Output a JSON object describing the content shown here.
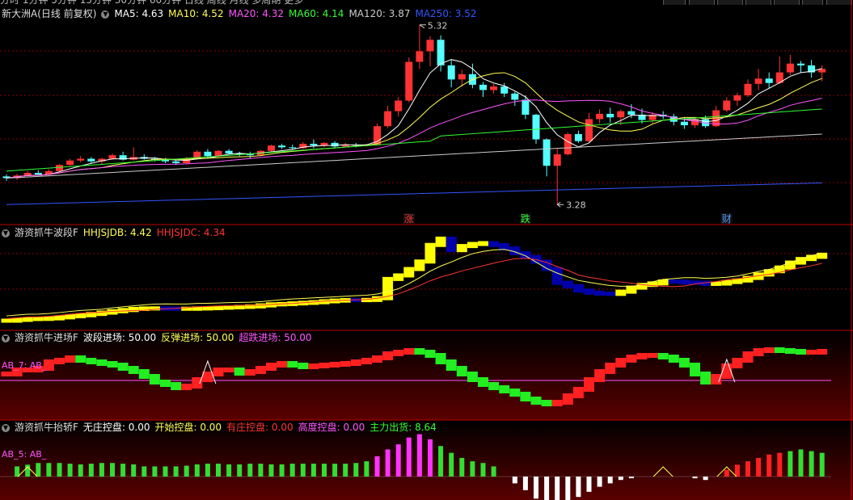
{
  "colors": {
    "up": "#ff3333",
    "down": "#54ffff",
    "ma5": "#ffffff",
    "ma10": "#ffff55",
    "ma20": "#ff55ff",
    "ma60": "#33ff33",
    "ma120": "#cccccc",
    "ma250": "#3355ff",
    "grid": "#8b0000"
  },
  "main": {
    "title": "新大洲A(日线 前复权)",
    "ma": [
      {
        "label": "MA5: 4.63",
        "color": "#ffffff"
      },
      {
        "label": "MA10: 4.52",
        "color": "#ffff55"
      },
      {
        "label": "MA20: 4.32",
        "color": "#ff55ff"
      },
      {
        "label": "MA60: 4.14",
        "color": "#33ff33"
      },
      {
        "label": "MA120: 3.87",
        "color": "#cccccc"
      },
      {
        "label": "MA250: 3.52",
        "color": "#3355ff"
      }
    ],
    "high_label": "5.32",
    "low_label": "3.28",
    "markers": [
      "涨",
      "跌",
      "财"
    ]
  },
  "panel2": {
    "title": "游资抓牛波段F",
    "items": [
      {
        "label": "HHJSJDB: 4.42",
        "color": "#ffff55"
      },
      {
        "label": "HHJSJDC: 4.34",
        "color": "#ff3333"
      }
    ]
  },
  "panel3": {
    "title": "游资抓牛进场F",
    "items": [
      {
        "label": "波段进场: 50.00",
        "color": "#ffffff"
      },
      {
        "label": "反弹进场: 50.00",
        "color": "#ffff55"
      },
      {
        "label": "超跌进场: 50.00",
        "color": "#ff55ff"
      }
    ],
    "side_label": "AB_7: AB_"
  },
  "panel4": {
    "title": "游资抓牛抬轿F",
    "items": [
      {
        "label": "无庄控盘: 0.00",
        "color": "#ffffff"
      },
      {
        "label": "开始控盘: 0.00",
        "color": "#ffff55"
      },
      {
        "label": "有庄控盘: 0.00",
        "color": "#ff3333"
      },
      {
        "label": "高度控盘: 0.00",
        "color": "#ff55ff"
      },
      {
        "label": "主力出货: 8.64",
        "color": "#33ff33"
      }
    ],
    "side_label": "AB_5: AB_"
  },
  "price_data": {
    "ohlc": [
      [
        3.6,
        3.62,
        3.55,
        3.58
      ],
      [
        3.58,
        3.63,
        3.56,
        3.61
      ],
      [
        3.61,
        3.66,
        3.6,
        3.64
      ],
      [
        3.64,
        3.67,
        3.61,
        3.62
      ],
      [
        3.62,
        3.68,
        3.61,
        3.66
      ],
      [
        3.66,
        3.74,
        3.65,
        3.73
      ],
      [
        3.73,
        3.8,
        3.72,
        3.78
      ],
      [
        3.78,
        3.83,
        3.76,
        3.8
      ],
      [
        3.8,
        3.82,
        3.75,
        3.77
      ],
      [
        3.77,
        3.81,
        3.74,
        3.8
      ],
      [
        3.8,
        3.86,
        3.79,
        3.84
      ],
      [
        3.84,
        3.88,
        3.78,
        3.79
      ],
      [
        3.79,
        3.93,
        3.78,
        3.82
      ],
      [
        3.82,
        3.85,
        3.79,
        3.8
      ],
      [
        3.8,
        3.82,
        3.77,
        3.79
      ],
      [
        3.79,
        3.81,
        3.75,
        3.77
      ],
      [
        3.77,
        3.8,
        3.73,
        3.75
      ],
      [
        3.75,
        3.82,
        3.74,
        3.8
      ],
      [
        3.8,
        3.9,
        3.79,
        3.88
      ],
      [
        3.88,
        3.91,
        3.81,
        3.83
      ],
      [
        3.83,
        3.9,
        3.82,
        3.89
      ],
      [
        3.89,
        3.91,
        3.85,
        3.86
      ],
      [
        3.86,
        3.88,
        3.83,
        3.85
      ],
      [
        3.85,
        3.88,
        3.8,
        3.84
      ],
      [
        3.84,
        3.9,
        3.83,
        3.89
      ],
      [
        3.89,
        3.96,
        3.88,
        3.95
      ],
      [
        3.95,
        3.97,
        3.91,
        3.93
      ],
      [
        3.93,
        3.96,
        3.9,
        3.92
      ],
      [
        3.92,
        3.99,
        3.91,
        3.97
      ],
      [
        3.97,
        4.02,
        3.92,
        3.95
      ],
      [
        3.95,
        3.99,
        3.93,
        3.98
      ],
      [
        3.98,
        4.0,
        3.92,
        3.94
      ],
      [
        3.94,
        3.98,
        3.93,
        3.96
      ],
      [
        3.96,
        3.98,
        3.93,
        3.95
      ],
      [
        3.95,
        3.97,
        3.94,
        3.96
      ],
      [
        3.96,
        4.2,
        3.95,
        4.17
      ],
      [
        4.17,
        4.4,
        4.15,
        4.34
      ],
      [
        4.34,
        4.5,
        4.28,
        4.46
      ],
      [
        4.46,
        4.95,
        4.44,
        4.9
      ],
      [
        4.9,
        5.32,
        4.82,
        5.02
      ],
      [
        5.02,
        5.19,
        4.85,
        5.15
      ],
      [
        5.15,
        5.2,
        4.79,
        4.86
      ],
      [
        4.86,
        4.92,
        4.61,
        4.7
      ],
      [
        4.7,
        4.81,
        4.62,
        4.76
      ],
      [
        4.76,
        4.88,
        4.6,
        4.64
      ],
      [
        4.64,
        4.67,
        4.5,
        4.58
      ],
      [
        4.58,
        4.65,
        4.54,
        4.62
      ],
      [
        4.62,
        4.66,
        4.5,
        4.54
      ],
      [
        4.54,
        4.56,
        4.4,
        4.47
      ],
      [
        4.47,
        4.52,
        4.25,
        4.3
      ],
      [
        4.3,
        4.31,
        3.97,
        4.02
      ],
      [
        4.02,
        4.03,
        3.6,
        3.72
      ],
      [
        3.72,
        3.92,
        3.28,
        3.85
      ],
      [
        3.85,
        4.1,
        3.84,
        4.08
      ],
      [
        4.08,
        4.12,
        3.98,
        4.0
      ],
      [
        4.0,
        4.32,
        3.99,
        4.25
      ],
      [
        4.25,
        4.36,
        4.2,
        4.31
      ],
      [
        4.31,
        4.38,
        4.21,
        4.27
      ],
      [
        4.27,
        4.36,
        4.18,
        4.34
      ],
      [
        4.34,
        4.42,
        4.26,
        4.3
      ],
      [
        4.3,
        4.37,
        4.2,
        4.24
      ],
      [
        4.24,
        4.33,
        4.2,
        4.3
      ],
      [
        4.3,
        4.34,
        4.25,
        4.28
      ],
      [
        4.28,
        4.31,
        4.18,
        4.22
      ],
      [
        4.22,
        4.27,
        4.14,
        4.18
      ],
      [
        4.18,
        4.27,
        4.15,
        4.25
      ],
      [
        4.25,
        4.29,
        4.15,
        4.17
      ],
      [
        4.17,
        4.4,
        4.16,
        4.35
      ],
      [
        4.35,
        4.5,
        4.33,
        4.46
      ],
      [
        4.46,
        4.55,
        4.4,
        4.52
      ],
      [
        4.52,
        4.7,
        4.5,
        4.65
      ],
      [
        4.65,
        4.82,
        4.58,
        4.71
      ],
      [
        4.71,
        4.78,
        4.6,
        4.66
      ],
      [
        4.66,
        4.96,
        4.65,
        4.78
      ],
      [
        4.78,
        4.98,
        4.75,
        4.88
      ],
      [
        4.88,
        4.91,
        4.78,
        4.86
      ],
      [
        4.86,
        4.92,
        4.72,
        4.78
      ],
      [
        4.78,
        4.86,
        4.68,
        4.82
      ]
    ]
  }
}
